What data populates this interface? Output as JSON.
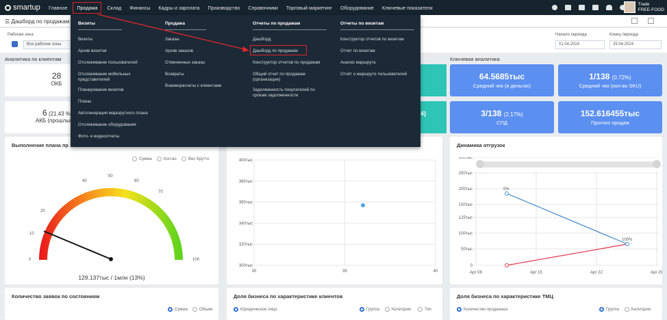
{
  "app": {
    "logo": "smartup"
  },
  "nav": {
    "items": [
      "Главное",
      "Продажа",
      "Склад",
      "Финансы",
      "Кадры и зарплата",
      "Производство",
      "Справочники",
      "Торговый маркетинг",
      "Оборудование",
      "Ключевые показатели"
    ]
  },
  "user": {
    "name": "Trade",
    "company": "FREE-FOOD"
  },
  "page": {
    "title": "Дашборд по продажам"
  },
  "filters": {
    "work_zone_label": "Рабочая зона",
    "work_zone_value": "Все рабочие зоны",
    "start_label": "Начало периода",
    "start_value": "01.04.2024",
    "end_label": "Конец периода",
    "end_value": "25.04.2024"
  },
  "sections": {
    "clients": "Аналитика по клиентам",
    "key": "Ключевая аналитика"
  },
  "client_cards": {
    "okb_value": "28",
    "okb_label": "ОКБ",
    "akb_value": "6",
    "akb_pct": "(21.43 %",
    "akb_label": "АКБ (прошлый п"
  },
  "teal": {
    "partial": "4)"
  },
  "kpis": [
    {
      "value": "64.5685тыс",
      "pct": "",
      "label": "Средний чек (в деньгах)"
    },
    {
      "value": "1/138",
      "pct": "(0.72%)",
      "label": "Средний чек (кол-во SKU)"
    },
    {
      "value": "3/138",
      "pct": "(2.17%)",
      "label": "СПД"
    },
    {
      "value": "152.616455тыс",
      "pct": "",
      "label": "Прогноз продаж"
    }
  ],
  "plan": {
    "title": "Выполнение плана пр",
    "radios": [
      "Сумма",
      "Кол-во",
      "Вес брутто"
    ],
    "ticks": [
      "0",
      "10",
      "20",
      "40",
      "50",
      "60",
      "70",
      "100"
    ],
    "value_text": "129.137тыс / 1млн (13%)"
  },
  "scatter": {
    "y_ticks": [
      "400тыс",
      "380тыс",
      "360тыс",
      "340тыс",
      "320тыс",
      "300тыс"
    ],
    "x_ticks": [
      "30",
      "35",
      "40"
    ],
    "point": {
      "x": 36,
      "y": 357
    }
  },
  "shipments": {
    "title": "Динамика отгрузок",
    "y_ticks": [
      "300тыс",
      "250тыс",
      "200тыс",
      "150тыс",
      "125тыс",
      "100тыс",
      "50тыс",
      "0"
    ],
    "x_ticks": [
      "Apr 08",
      "Apr 15",
      "Apr 22",
      "Apr 29"
    ],
    "labels": {
      "a": "0%",
      "b": "100%"
    }
  },
  "bottom": {
    "orders_title": "Количество заявок по состояниям",
    "orders_radios": [
      "Сумма",
      "Объем"
    ],
    "clients_title": "Доля бизнеса по характеристике клиентов",
    "clients_radio": "Юридическое лицо",
    "clients_radios": [
      "Группа",
      "Категория",
      "Тип"
    ],
    "tmc_title": "Доля бизнеса по характеристике ТМЦ",
    "tmc_radio": "Количество проданных",
    "tmc_radios": [
      "Группа",
      "Категория"
    ]
  },
  "menu": {
    "visits": {
      "heading": "Визиты",
      "items": [
        "Визиты",
        "Архив визитов",
        "Отслеживание пользователей",
        "Отслеживание мобильных представителей",
        "Планирование визитов",
        "Планы",
        "Автогенерация маршрутного плана",
        "Отслеживание оборудования",
        "Фото- и видеоотчеты"
      ]
    },
    "sales": {
      "heading": "Продажа",
      "items": [
        "Заказы",
        "Архив заказов",
        "Отмененные заказы",
        "Возвраты",
        "Взаиморасчеты с клиентами"
      ]
    },
    "sales_reports": {
      "heading": "Отчеты по продажам",
      "items": [
        "Дашборд",
        "Дашборд по продажам",
        "Конструктор отчетов по продажам",
        "Общий отчет по продажам (организации)",
        "Задолженность покупателей по срокам задолженности"
      ]
    },
    "visit_reports": {
      "heading": "Отчеты по визитам",
      "items": [
        "Конструктор отчетов по визитам",
        "Отчет по визитам",
        "Анализ маршрута",
        "Отчёт о маршруте пользователей"
      ]
    }
  }
}
